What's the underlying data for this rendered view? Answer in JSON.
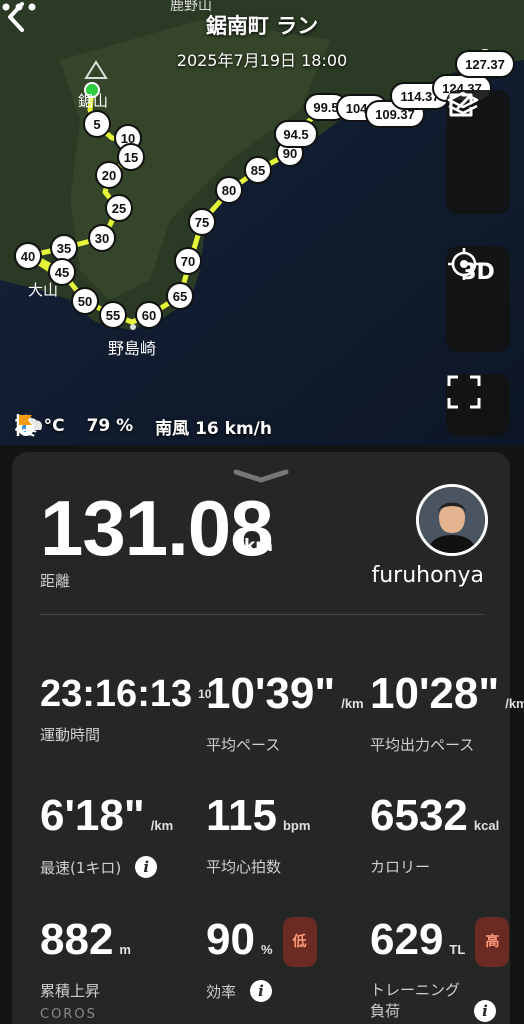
{
  "header": {
    "title": "鋸南町 ラン",
    "date": "2025年7月19日 18:00"
  },
  "map": {
    "place_labels": [
      "鹿野山",
      "鋸山",
      "大山",
      "野島崎"
    ],
    "km_markers": [
      "5",
      "10",
      "15",
      "20",
      "25",
      "30",
      "35",
      "40",
      "45",
      "50",
      "55",
      "60",
      "65",
      "70",
      "75",
      "80",
      "85",
      "90",
      "94.5",
      "99.5",
      "104.5",
      "109.37",
      "114.37",
      "124.37",
      "127.37"
    ],
    "route_color": "#e4f53a",
    "start_color": "#2ecc40",
    "end_color": "#e0212e"
  },
  "controls": {
    "view_3d_label": "3D"
  },
  "weather": {
    "temperature": "28 °C",
    "humidity": "79 %",
    "wind": "南風 16 km/h"
  },
  "summary": {
    "distance": "131.08",
    "distance_unit": "km",
    "distance_label": "距離",
    "username": "furuhonya"
  },
  "stats": [
    {
      "value": "23:16:13",
      "sub": "10",
      "unit": "",
      "label": "運動時間"
    },
    {
      "value": "10'39\"",
      "unit": "/km",
      "label": "平均ペース"
    },
    {
      "value": "10'28\"",
      "unit": "/km",
      "label": "平均出力ペース"
    },
    {
      "value": "6'18\"",
      "unit": "/km",
      "label": "最速(1キロ)"
    },
    {
      "value": "115",
      "unit": "bpm",
      "label": "平均心拍数"
    },
    {
      "value": "6532",
      "unit": "kcal",
      "label": "カロリー"
    },
    {
      "value": "882",
      "unit": "m",
      "label": "累積上昇"
    },
    {
      "value": "90",
      "unit": "%",
      "label": "効率",
      "badge": "低"
    },
    {
      "value": "629",
      "unit": "TL",
      "label": "トレーニング負荷",
      "label_line2": "負荷",
      "label_line1": "トレーニング",
      "badge": "高"
    }
  ],
  "footer": {
    "brand": "COROS"
  }
}
